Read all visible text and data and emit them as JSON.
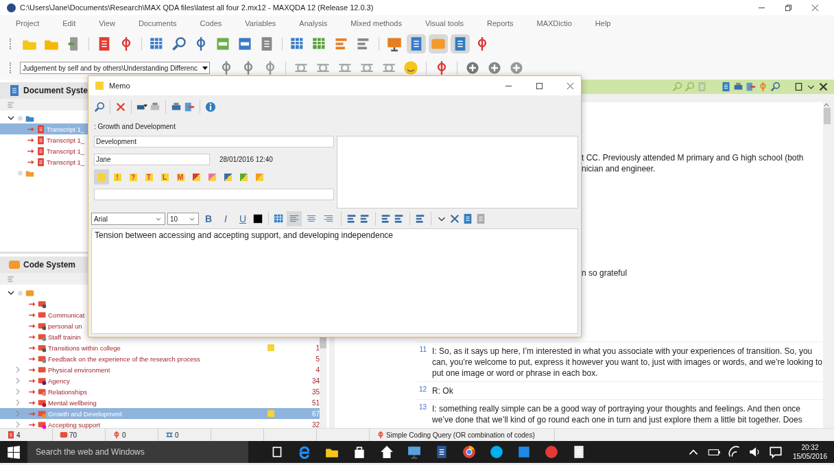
{
  "window": {
    "title": "C:\\Users\\Jane\\Documents\\Research\\MAX QDA files\\latest all four 2.mx12 - MAXQDA 12  (Release 12.0.3)"
  },
  "menu": [
    "Project",
    "Edit",
    "View",
    "Documents",
    "Codes",
    "Variables",
    "Analysis",
    "Mixed methods",
    "Visual tools",
    "Reports",
    "MAXDictio",
    "Help"
  ],
  "panel_toggles": [
    {
      "pressed": true
    },
    {
      "pressed": true
    },
    {
      "pressed": true
    },
    {
      "pressed": false
    }
  ],
  "code_selector": {
    "value": "Judgement by self and by others\\Understanding Differenc"
  },
  "document_system": {
    "title": "Document Syste",
    "expanded": true,
    "items": [
      {
        "name": "Transcript 1_",
        "selected": true
      },
      {
        "name": "Transcript 1_",
        "selected": false
      },
      {
        "name": "Transcript 1_",
        "selected": false
      },
      {
        "name": "Transcript 1_",
        "selected": false
      }
    ]
  },
  "code_system": {
    "title": "Code System",
    "expanded": true,
    "codes": [
      {
        "color": "#555555",
        "expandable": false,
        "selected": false
      },
      {
        "name": "Communicat",
        "expandable": false,
        "selected": false
      },
      {
        "name": "personal un",
        "color": "#555555",
        "expandable": false,
        "selected": false
      },
      {
        "name": "Staff trainin",
        "color": "#888888",
        "expandable": false,
        "selected": false
      },
      {
        "name": "Transitions within college",
        "color": "#555555",
        "count": "1",
        "expandable": false,
        "memo": true,
        "selected": false
      },
      {
        "name": "Feedback on the experience of the research process",
        "color": "#888888",
        "count": "5",
        "expandable": false,
        "memo": false,
        "selected": false
      },
      {
        "name": "Physical environment",
        "count": "4",
        "expandable": true,
        "memo": false,
        "selected": false
      },
      {
        "name": "Agency",
        "color": "#5b1a8c",
        "count": "34",
        "expandable": true,
        "memo": false,
        "selected": false
      },
      {
        "name": "Relationships",
        "color": "#f08080",
        "count": "35",
        "expandable": true,
        "memo": false,
        "selected": false
      },
      {
        "name": "Mental wellbeing",
        "color": "#c0141e",
        "count": "51",
        "expandable": true,
        "memo": false,
        "selected": false
      },
      {
        "name": "Growth and Development",
        "color": "#ff8c00",
        "count": "67",
        "expandable": true,
        "memo": true,
        "selected": true
      },
      {
        "name": "Accepting support",
        "color": "#ff00c8",
        "count": "32",
        "expandable": true,
        "memo": false,
        "selected": false
      }
    ]
  },
  "document_browser": {
    "blocks": [
      {
        "kind": "fragment",
        "lines": [
          "t CC. Previously attended M primary and G high school (both",
          "nician and engineer."
        ]
      },
      {
        "kind": "fragment",
        "lines": [
          "n so grateful"
        ]
      },
      {
        "kind": "paragraph",
        "number": "11",
        "text": "I: So, as it says up here, I’m interested in what you associate with your experiences of transition. So, you can, you’re welcome to put, express it however you want to, just with images or words, and we’re looking to put one image or word or phrase in each box."
      },
      {
        "kind": "paragraph",
        "number": "12",
        "text": "R: Ok"
      },
      {
        "kind": "paragraph",
        "number": "13",
        "text": "I: something really simple can be a good way of portraying your thoughts and feelings. And then once we’ve done that we’ll kind of go round each one in turn and just explore them a little bit together. Does"
      }
    ]
  },
  "memo": {
    "title": "Memo",
    "code_label": ": Growth and Development",
    "memo_title": "Development",
    "author": "Jane",
    "date": "28/01/2016 12:40",
    "types": [
      {
        "kind": "plain",
        "selected": true
      },
      {
        "kind": "letter",
        "label": "!",
        "selected": false
      },
      {
        "kind": "letter",
        "label": "?",
        "selected": false
      },
      {
        "kind": "letter",
        "label": "T",
        "selected": false
      },
      {
        "kind": "letter",
        "label": "L",
        "selected": false
      },
      {
        "kind": "letter",
        "label": "M",
        "selected": false
      },
      {
        "kind": "corner",
        "color": "#e03c31",
        "selected": false
      },
      {
        "kind": "corner",
        "color": "#f06eaa",
        "selected": false
      },
      {
        "kind": "corner",
        "color": "#3a6ea5",
        "selected": false
      },
      {
        "kind": "corner",
        "color": "#5aaa2a",
        "selected": false
      },
      {
        "kind": "corner",
        "color": "#f39a2b",
        "selected": false
      }
    ],
    "font": "Arial",
    "size": "10",
    "bold_label": "B",
    "italic_label": "I",
    "underline_label": "U",
    "alignment": [
      {
        "selected": true
      },
      {
        "selected": false
      },
      {
        "selected": false
      }
    ],
    "text": "Tension between accessing and accepting support, and developing independence"
  },
  "status_bar": [
    "4",
    "70",
    "0",
    "0",
    "Simple Coding Query (OR combination of codes)"
  ],
  "taskbar": {
    "search_placeholder": "Search the web and Windows",
    "time": "20:32",
    "date": "15/05/2016"
  }
}
